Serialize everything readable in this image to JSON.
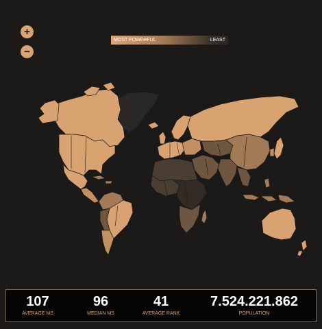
{
  "controls": {
    "zoom_in": "+",
    "zoom_out": "−"
  },
  "legend": {
    "low": "MOST POWERFUL",
    "high": "LEAST"
  },
  "stats": {
    "average_ms": {
      "value": "107",
      "label": "AVERAGE MS"
    },
    "median_ms": {
      "value": "96",
      "label": "MEDIAN MS"
    },
    "average_rank": {
      "value": "41",
      "label": "AVERAGE RANK"
    },
    "population": {
      "value": "7.524.221.862",
      "label": "POPULATION"
    }
  },
  "colors": {
    "background": "#1b1a19",
    "accent": "#d9a472",
    "most_powerful": "#dba674",
    "least": "#2a2622"
  }
}
